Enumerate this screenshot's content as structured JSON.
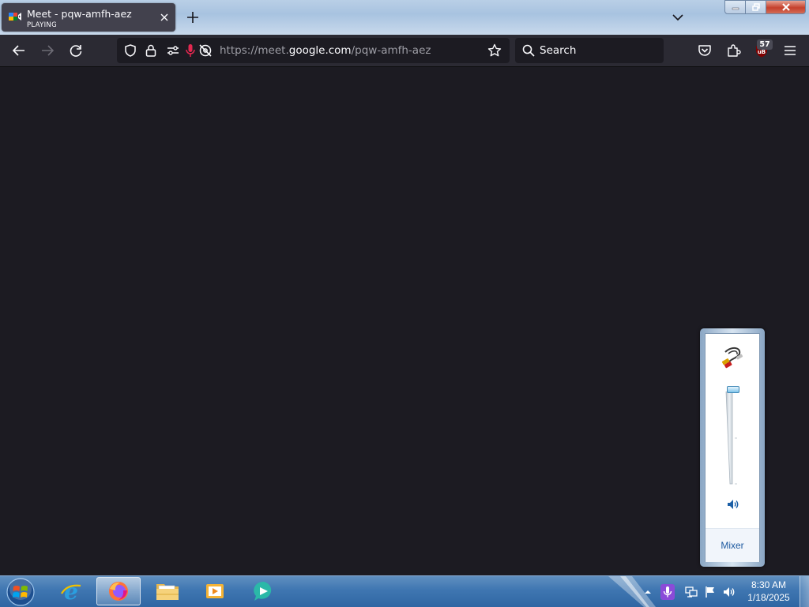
{
  "browser": {
    "tab": {
      "title": "Meet - pqw-amfh-aez",
      "status": "PLAYING"
    },
    "url": {
      "prefix": "https://meet.",
      "host": "google.com",
      "path": "/pqw-amfh-aez"
    },
    "search_placeholder": "Search",
    "extension_badge": "57"
  },
  "volume_flyout": {
    "mixer_label": "Mixer",
    "volume_level_percent": 100
  },
  "taskbar": {
    "time": "8:30 AM",
    "date": "1/18/2025",
    "apps": [
      "internet-explorer",
      "firefox",
      "file-explorer",
      "media-player",
      "chat-app"
    ]
  },
  "colors": {
    "content_bg": "#1c1b22",
    "toolbar_bg": "#2b2a33",
    "tab_bg": "#42414d",
    "mic_active": "#e22850",
    "taskbar": "#3f76b1"
  }
}
